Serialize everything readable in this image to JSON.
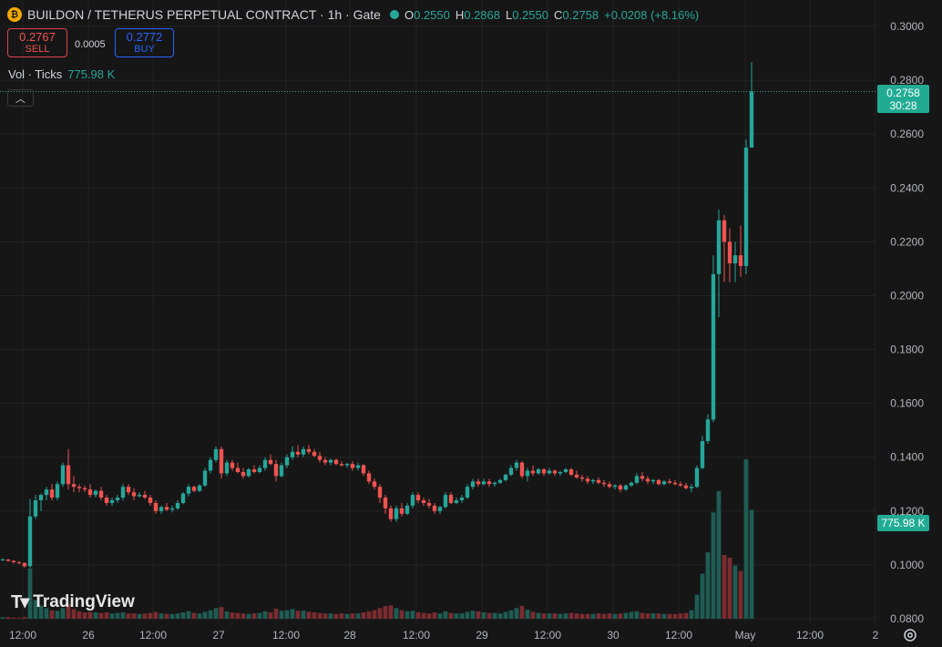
{
  "header": {
    "title": "BUILDON / TETHERUS PERPETUAL CONTRACT · 1h · Gate",
    "o_label": "O",
    "o_value": "0.2550",
    "h_label": "H",
    "h_value": "0.2868",
    "l_label": "L",
    "l_value": "0.2550",
    "c_label": "C",
    "c_value": "0.2758",
    "change": "+0.0208 (+8.16%)"
  },
  "trade": {
    "sell_price": "0.2767",
    "sell_label": "SELL",
    "spread": "0.0005",
    "buy_price": "0.2772",
    "buy_label": "BUY"
  },
  "volume_legend": {
    "label": "Vol · Ticks",
    "value": "775.98 K"
  },
  "last_price": {
    "price": "0.2758",
    "countdown": "30:28"
  },
  "volume_badge": "775.98 K",
  "logo_text": "TradingView",
  "colors": {
    "up": "#26a69a",
    "down": "#ef5350",
    "vol_up": "#1e5c54",
    "vol_down": "#7a2c30"
  },
  "chart_data": {
    "type": "candlestick",
    "y_ticks": [
      "0.3000",
      "0.2800",
      "0.2600",
      "0.2400",
      "0.2200",
      "0.2000",
      "0.1800",
      "0.1600",
      "0.1400",
      "0.1200",
      "0.1000",
      "0.0800"
    ],
    "x_ticks": [
      "12:00",
      "26",
      "12:00",
      "27",
      "12:00",
      "28",
      "12:00",
      "29",
      "12:00",
      "30",
      "12:00",
      "May",
      "12:00",
      "2"
    ],
    "ylim": [
      0.08,
      0.3
    ],
    "ohlc": [
      [
        0.102,
        0.1025,
        0.1015,
        0.102
      ],
      [
        0.102,
        0.1022,
        0.1012,
        0.1015
      ],
      [
        0.1015,
        0.1018,
        0.1005,
        0.101
      ],
      [
        0.101,
        0.1014,
        0.1002,
        0.1007
      ],
      [
        0.1007,
        0.101,
        0.099,
        0.0995
      ],
      [
        0.0995,
        0.1245,
        0.099,
        0.118
      ],
      [
        0.118,
        0.126,
        0.117,
        0.124
      ],
      [
        0.124,
        0.1265,
        0.12,
        0.126
      ],
      [
        0.126,
        0.129,
        0.124,
        0.128
      ],
      [
        0.128,
        0.13,
        0.124,
        0.125
      ],
      [
        0.125,
        0.131,
        0.124,
        0.13
      ],
      [
        0.13,
        0.138,
        0.129,
        0.137
      ],
      [
        0.137,
        0.143,
        0.128,
        0.13
      ],
      [
        0.13,
        0.133,
        0.127,
        0.129
      ],
      [
        0.129,
        0.13,
        0.127,
        0.1285
      ],
      [
        0.1285,
        0.1295,
        0.127,
        0.128
      ],
      [
        0.128,
        0.13,
        0.125,
        0.126
      ],
      [
        0.126,
        0.128,
        0.125,
        0.1275
      ],
      [
        0.1275,
        0.129,
        0.124,
        0.125
      ],
      [
        0.125,
        0.126,
        0.122,
        0.123
      ],
      [
        0.123,
        0.125,
        0.122,
        0.124
      ],
      [
        0.124,
        0.126,
        0.123,
        0.125
      ],
      [
        0.125,
        0.13,
        0.124,
        0.129
      ],
      [
        0.129,
        0.13,
        0.126,
        0.127
      ],
      [
        0.127,
        0.1285,
        0.124,
        0.1255
      ],
      [
        0.1255,
        0.127,
        0.125,
        0.126
      ],
      [
        0.126,
        0.1275,
        0.1245,
        0.125
      ],
      [
        0.125,
        0.126,
        0.122,
        0.123
      ],
      [
        0.123,
        0.124,
        0.119,
        0.12
      ],
      [
        0.12,
        0.122,
        0.119,
        0.1215
      ],
      [
        0.1215,
        0.123,
        0.12,
        0.1205
      ],
      [
        0.1205,
        0.122,
        0.1195,
        0.121
      ],
      [
        0.121,
        0.124,
        0.1205,
        0.123
      ],
      [
        0.123,
        0.127,
        0.1225,
        0.1265
      ],
      [
        0.1265,
        0.13,
        0.1255,
        0.129
      ],
      [
        0.129,
        0.1295,
        0.127,
        0.1275
      ],
      [
        0.1275,
        0.13,
        0.127,
        0.1295
      ],
      [
        0.1295,
        0.136,
        0.129,
        0.135
      ],
      [
        0.135,
        0.14,
        0.134,
        0.139
      ],
      [
        0.139,
        0.144,
        0.138,
        0.143
      ],
      [
        0.143,
        0.144,
        0.132,
        0.134
      ],
      [
        0.134,
        0.139,
        0.133,
        0.138
      ],
      [
        0.138,
        0.139,
        0.135,
        0.136
      ],
      [
        0.136,
        0.138,
        0.134,
        0.1345
      ],
      [
        0.1345,
        0.136,
        0.132,
        0.133
      ],
      [
        0.133,
        0.136,
        0.1325,
        0.1355
      ],
      [
        0.1355,
        0.137,
        0.134,
        0.1345
      ],
      [
        0.1345,
        0.137,
        0.134,
        0.136
      ],
      [
        0.136,
        0.14,
        0.135,
        0.139
      ],
      [
        0.139,
        0.141,
        0.137,
        0.1375
      ],
      [
        0.1375,
        0.139,
        0.131,
        0.133
      ],
      [
        0.133,
        0.138,
        0.1325,
        0.137
      ],
      [
        0.137,
        0.141,
        0.136,
        0.14
      ],
      [
        0.14,
        0.144,
        0.139,
        0.142
      ],
      [
        0.142,
        0.1445,
        0.14,
        0.141
      ],
      [
        0.141,
        0.144,
        0.14,
        0.143
      ],
      [
        0.143,
        0.1445,
        0.141,
        0.142
      ],
      [
        0.142,
        0.143,
        0.14,
        0.1405
      ],
      [
        0.1405,
        0.142,
        0.138,
        0.139
      ],
      [
        0.139,
        0.14,
        0.137,
        0.138
      ],
      [
        0.138,
        0.1395,
        0.137,
        0.139
      ],
      [
        0.139,
        0.1395,
        0.137,
        0.1375
      ],
      [
        0.1375,
        0.1385,
        0.1365,
        0.137
      ],
      [
        0.137,
        0.138,
        0.136,
        0.1375
      ],
      [
        0.1375,
        0.1385,
        0.135,
        0.136
      ],
      [
        0.136,
        0.138,
        0.135,
        0.137
      ],
      [
        0.137,
        0.1375,
        0.133,
        0.134
      ],
      [
        0.134,
        0.135,
        0.13,
        0.131
      ],
      [
        0.131,
        0.132,
        0.128,
        0.129
      ],
      [
        0.129,
        0.13,
        0.123,
        0.125
      ],
      [
        0.125,
        0.126,
        0.119,
        0.121
      ],
      [
        0.121,
        0.122,
        0.116,
        0.117
      ],
      [
        0.117,
        0.122,
        0.116,
        0.121
      ],
      [
        0.121,
        0.123,
        0.118,
        0.119
      ],
      [
        0.119,
        0.123,
        0.1185,
        0.122
      ],
      [
        0.122,
        0.127,
        0.121,
        0.126
      ],
      [
        0.126,
        0.127,
        0.123,
        0.124
      ],
      [
        0.124,
        0.125,
        0.122,
        0.123
      ],
      [
        0.123,
        0.1245,
        0.121,
        0.122
      ],
      [
        0.122,
        0.123,
        0.119,
        0.12
      ],
      [
        0.12,
        0.122,
        0.119,
        0.1215
      ],
      [
        0.1215,
        0.127,
        0.121,
        0.126
      ],
      [
        0.126,
        0.127,
        0.1225,
        0.123
      ],
      [
        0.123,
        0.125,
        0.1225,
        0.124
      ],
      [
        0.124,
        0.126,
        0.123,
        0.125
      ],
      [
        0.125,
        0.13,
        0.1245,
        0.129
      ],
      [
        0.129,
        0.132,
        0.128,
        0.131
      ],
      [
        0.131,
        0.132,
        0.129,
        0.13
      ],
      [
        0.13,
        0.132,
        0.1295,
        0.131
      ],
      [
        0.131,
        0.132,
        0.129,
        0.13
      ],
      [
        0.13,
        0.131,
        0.129,
        0.1305
      ],
      [
        0.1305,
        0.132,
        0.13,
        0.1315
      ],
      [
        0.1315,
        0.134,
        0.131,
        0.1335
      ],
      [
        0.1335,
        0.137,
        0.133,
        0.136
      ],
      [
        0.136,
        0.139,
        0.135,
        0.138
      ],
      [
        0.138,
        0.1385,
        0.132,
        0.133
      ],
      [
        0.133,
        0.136,
        0.131,
        0.135
      ],
      [
        0.135,
        0.137,
        0.133,
        0.134
      ],
      [
        0.134,
        0.136,
        0.1335,
        0.1355
      ],
      [
        0.1355,
        0.136,
        0.133,
        0.134
      ],
      [
        0.134,
        0.136,
        0.1335,
        0.135
      ],
      [
        0.135,
        0.1355,
        0.133,
        0.134
      ],
      [
        0.134,
        0.135,
        0.133,
        0.1345
      ],
      [
        0.1345,
        0.136,
        0.134,
        0.1355
      ],
      [
        0.1355,
        0.136,
        0.133,
        0.1335
      ],
      [
        0.1335,
        0.135,
        0.132,
        0.1325
      ],
      [
        0.1325,
        0.1335,
        0.131,
        0.132
      ],
      [
        0.132,
        0.133,
        0.13,
        0.131
      ],
      [
        0.131,
        0.132,
        0.13,
        0.1315
      ],
      [
        0.1315,
        0.1325,
        0.13,
        0.1305
      ],
      [
        0.1305,
        0.1315,
        0.129,
        0.13
      ],
      [
        0.13,
        0.131,
        0.1285,
        0.129
      ],
      [
        0.129,
        0.13,
        0.128,
        0.1295
      ],
      [
        0.1295,
        0.13,
        0.127,
        0.128
      ],
      [
        0.128,
        0.13,
        0.1275,
        0.1295
      ],
      [
        0.1295,
        0.131,
        0.129,
        0.1305
      ],
      [
        0.1305,
        0.134,
        0.13,
        0.133
      ],
      [
        0.133,
        0.1345,
        0.131,
        0.132
      ],
      [
        0.132,
        0.133,
        0.13,
        0.131
      ],
      [
        0.131,
        0.132,
        0.13,
        0.1315
      ],
      [
        0.1315,
        0.132,
        0.1295,
        0.13
      ],
      [
        0.13,
        0.1315,
        0.1295,
        0.131
      ],
      [
        0.131,
        0.132,
        0.13,
        0.1305
      ],
      [
        0.1305,
        0.1315,
        0.1295,
        0.13
      ],
      [
        0.13,
        0.131,
        0.129,
        0.1295
      ],
      [
        0.1295,
        0.1305,
        0.128,
        0.1285
      ],
      [
        0.1285,
        0.13,
        0.127,
        0.129
      ],
      [
        0.129,
        0.137,
        0.1285,
        0.136
      ],
      [
        0.136,
        0.148,
        0.1355,
        0.146
      ],
      [
        0.146,
        0.156,
        0.145,
        0.154
      ],
      [
        0.154,
        0.215,
        0.153,
        0.208
      ],
      [
        0.208,
        0.232,
        0.192,
        0.228
      ],
      [
        0.228,
        0.23,
        0.205,
        0.22
      ],
      [
        0.22,
        0.225,
        0.205,
        0.212
      ],
      [
        0.212,
        0.22,
        0.205,
        0.215
      ],
      [
        0.215,
        0.226,
        0.207,
        0.211
      ],
      [
        0.211,
        0.258,
        0.208,
        0.255
      ],
      [
        0.255,
        0.2868,
        0.255,
        0.2758
      ]
    ],
    "volume": [
      0.3,
      0.3,
      0.2,
      0.2,
      0.3,
      9.5,
      3.5,
      2.5,
      2.0,
      1.6,
      1.5,
      2.0,
      2.8,
      1.8,
      1.4,
      1.2,
      1.3,
      1.2,
      1.1,
      1.2,
      1.0,
      1.1,
      1.2,
      1.0,
      1.0,
      0.9,
      1.0,
      1.1,
      1.3,
      1.0,
      0.9,
      0.9,
      1.0,
      1.2,
      1.4,
      1.1,
      1.0,
      1.3,
      1.6,
      2.0,
      2.2,
      1.4,
      1.2,
      1.1,
      1.0,
      0.9,
      1.0,
      1.1,
      1.4,
      1.2,
      1.9,
      1.5,
      1.6,
      1.8,
      1.5,
      1.5,
      1.3,
      1.2,
      1.1,
      1.0,
      1.0,
      0.9,
      1.0,
      0.9,
      1.0,
      1.0,
      1.2,
      1.4,
      1.6,
      2.0,
      2.4,
      2.5,
      2.0,
      1.6,
      1.4,
      1.5,
      1.2,
      1.1,
      1.0,
      1.2,
      1.0,
      1.4,
      1.1,
      1.0,
      1.0,
      1.3,
      1.5,
      1.4,
      1.2,
      1.1,
      1.1,
      1.0,
      1.3,
      1.6,
      2.0,
      2.4,
      1.7,
      1.3,
      1.1,
      1.0,
      1.0,
      1.0,
      0.9,
      1.0,
      1.1,
      1.0,
      0.9,
      0.9,
      0.9,
      1.0,
      0.9,
      1.0,
      0.9,
      1.0,
      1.1,
      1.3,
      1.4,
      1.1,
      1.0,
      1.0,
      1.0,
      0.9,
      0.9,
      0.9,
      1.0,
      1.1,
      1.6,
      4.5,
      8.5,
      12.5,
      20.0,
      24.0,
      12.0,
      11.5,
      10.0,
      9.0,
      30.0,
      20.5
    ]
  }
}
